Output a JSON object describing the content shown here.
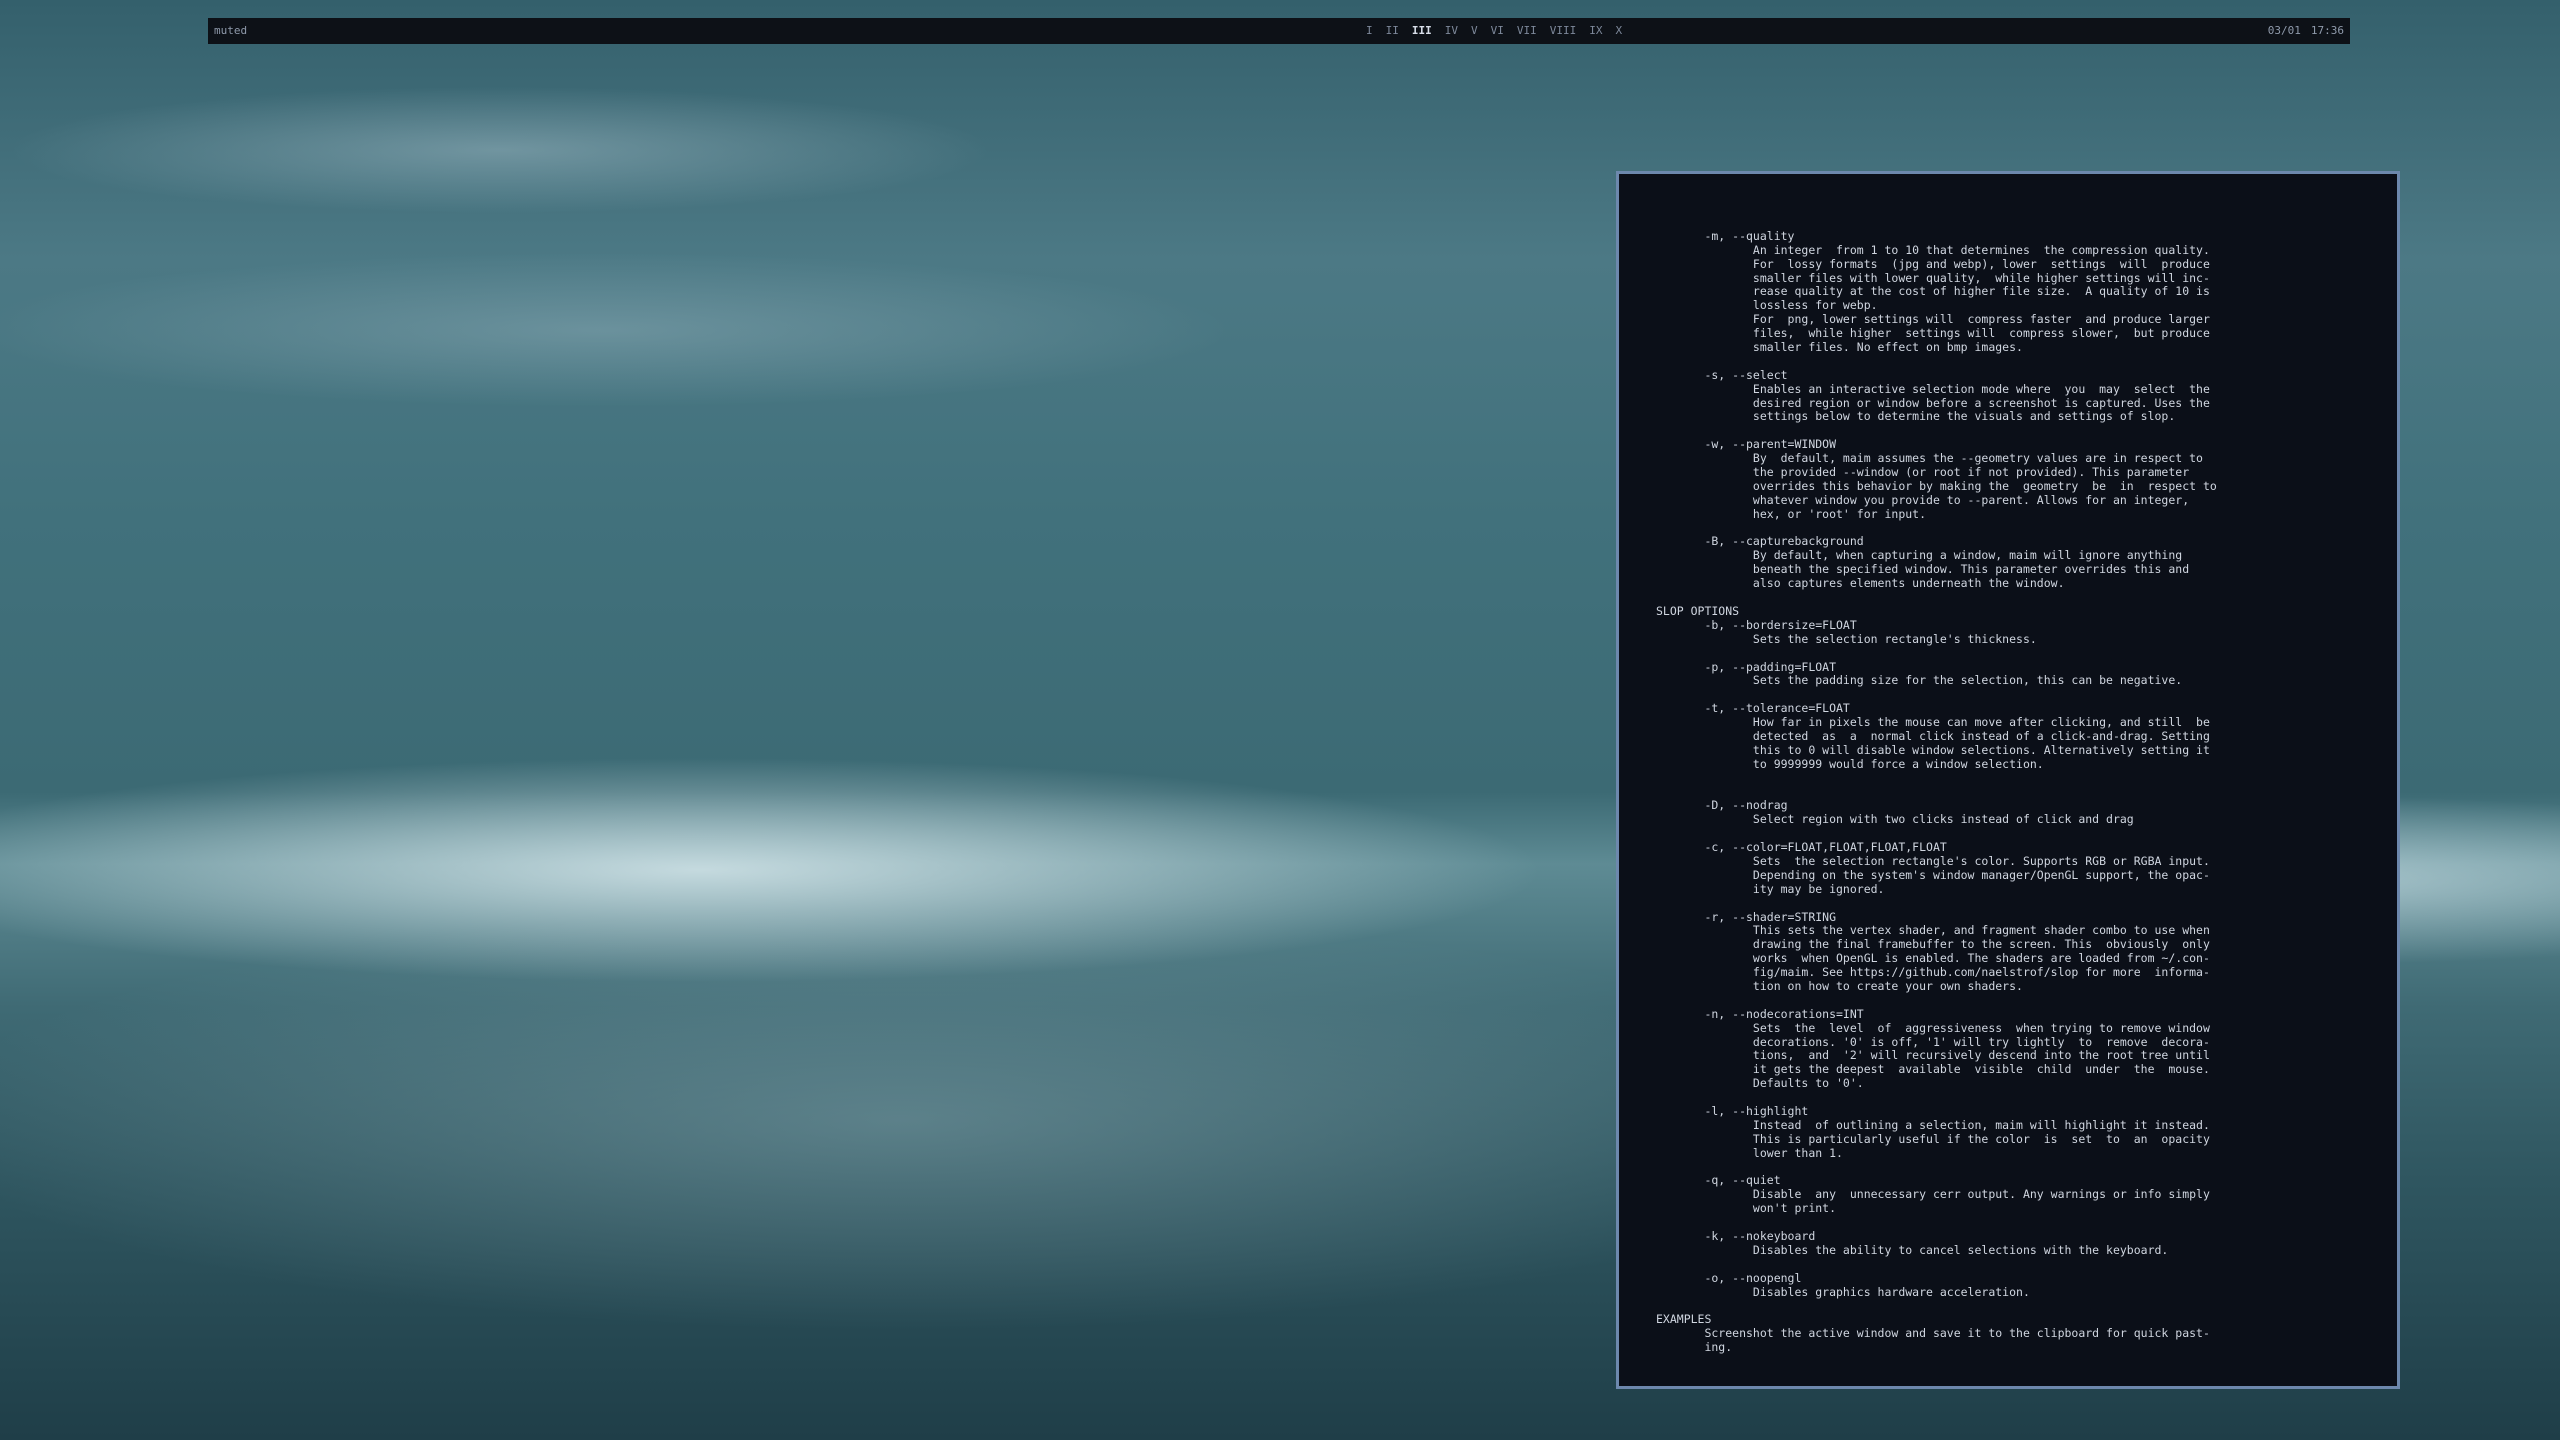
{
  "topbar": {
    "left_status": "muted",
    "workspaces": [
      {
        "label": "I",
        "active": false
      },
      {
        "label": "II",
        "active": false
      },
      {
        "label": "III",
        "active": true
      },
      {
        "label": "IV",
        "active": false
      },
      {
        "label": "V",
        "active": false
      },
      {
        "label": "VI",
        "active": false
      },
      {
        "label": "VII",
        "active": false
      },
      {
        "label": "VIII",
        "active": false
      },
      {
        "label": "IX",
        "active": false
      },
      {
        "label": "X",
        "active": false
      }
    ],
    "date": "03/01",
    "time": "17:36"
  },
  "terminal": {
    "lines": [
      "",
      "       -m, --quality",
      "              An integer  from 1 to 10 that determines  the compression quality.",
      "              For  lossy formats  (jpg and webp), lower  settings  will  produce",
      "              smaller files with lower quality,  while higher settings will inc-",
      "              rease quality at the cost of higher file size.  A quality of 10 is",
      "              lossless for webp.",
      "              For  png, lower settings will  compress faster  and produce larger",
      "              files,  while higher  settings will  compress slower,  but produce",
      "              smaller files. No effect on bmp images.",
      "",
      "       -s, --select",
      "              Enables an interactive selection mode where  you  may  select  the",
      "              desired region or window before a screenshot is captured. Uses the",
      "              settings below to determine the visuals and settings of slop.",
      "",
      "       -w, --parent=WINDOW",
      "              By  default, maim assumes the --geometry values are in respect to",
      "              the provided --window (or root if not provided). This parameter",
      "              overrides this behavior by making the  geometry  be  in  respect to",
      "              whatever window you provide to --parent. Allows for an integer,",
      "              hex, or 'root' for input.",
      "",
      "       -B, --capturebackground",
      "              By default, when capturing a window, maim will ignore anything",
      "              beneath the specified window. This parameter overrides this and",
      "              also captures elements underneath the window.",
      "",
      "SLOP OPTIONS",
      "       -b, --bordersize=FLOAT",
      "              Sets the selection rectangle's thickness.",
      "",
      "       -p, --padding=FLOAT",
      "              Sets the padding size for the selection, this can be negative.",
      "",
      "       -t, --tolerance=FLOAT",
      "              How far in pixels the mouse can move after clicking, and still  be",
      "              detected  as  a  normal click instead of a click-and-drag. Setting",
      "              this to 0 will disable window selections. Alternatively setting it",
      "              to 9999999 would force a window selection.",
      "",
      "",
      "       -D, --nodrag",
      "              Select region with two clicks instead of click and drag",
      "",
      "       -c, --color=FLOAT,FLOAT,FLOAT,FLOAT",
      "              Sets  the selection rectangle's color. Supports RGB or RGBA input.",
      "              Depending on the system's window manager/OpenGL support, the opac-",
      "              ity may be ignored.",
      "",
      "       -r, --shader=STRING",
      "              This sets the vertex shader, and fragment shader combo to use when",
      "              drawing the final framebuffer to the screen. This  obviously  only",
      "              works  when OpenGL is enabled. The shaders are loaded from ~/.con-",
      "              fig/maim. See https://github.com/naelstrof/slop for more  informa-",
      "              tion on how to create your own shaders.",
      "",
      "       -n, --nodecorations=INT",
      "              Sets  the  level  of  aggressiveness  when trying to remove window",
      "              decorations. '0' is off, '1' will try lightly  to  remove  decora-",
      "              tions,  and  '2' will recursively descend into the root tree until",
      "              it gets the deepest  available  visible  child  under  the  mouse.",
      "              Defaults to '0'.",
      "",
      "       -l, --highlight",
      "              Instead  of outlining a selection, maim will highlight it instead.",
      "              This is particularly useful if the color  is  set  to  an  opacity",
      "              lower than 1.",
      "",
      "       -q, --quiet",
      "              Disable  any  unnecessary cerr output. Any warnings or info simply",
      "              won't print.",
      "",
      "       -k, --nokeyboard",
      "              Disables the ability to cancel selections with the keyboard.",
      "",
      "       -o, --noopengl",
      "              Disables graphics hardware acceleration.",
      "",
      "EXAMPLES",
      "       Screenshot the active window and save it to the clipboard for quick past-",
      "       ing."
    ]
  }
}
